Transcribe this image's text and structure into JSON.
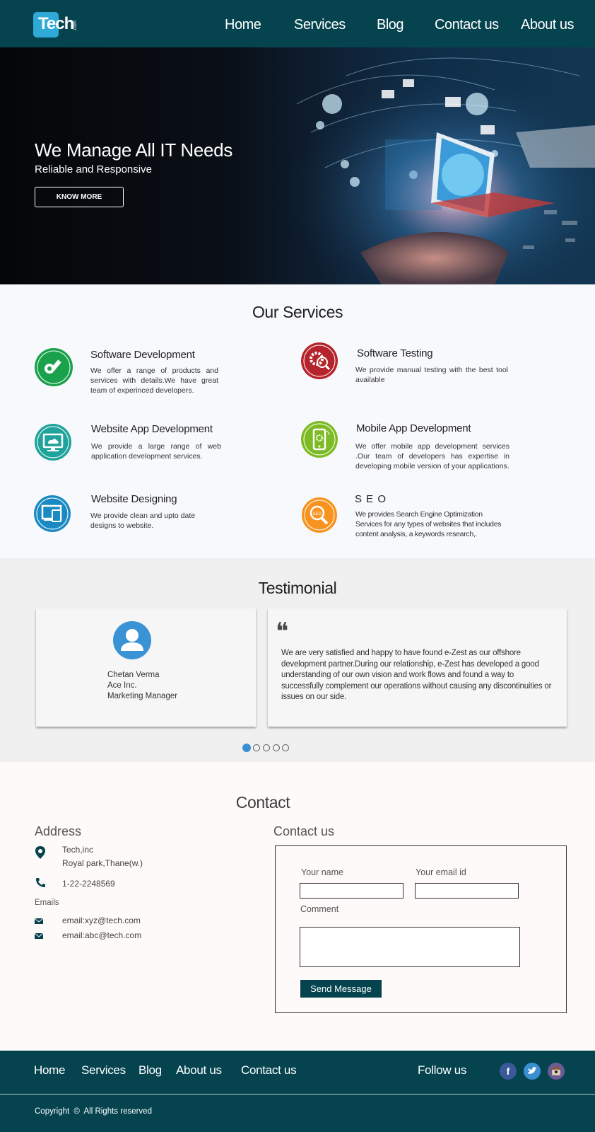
{
  "header": {
    "logo_text": "Tech",
    "logo_suffix": ".com",
    "nav": [
      "Home",
      "Services",
      "Blog",
      "Contact us",
      "About us"
    ]
  },
  "hero": {
    "title": "We Manage All IT Needs",
    "subtitle": "Reliable and Responsive",
    "button": "KNOW MORE"
  },
  "services": {
    "title": "Our Services",
    "items": [
      {
        "title": "Software Development",
        "desc": "We offer a range of products and services with details.We have great team of experinced developers.",
        "icon": "pencil-gear-icon",
        "color": "#1aa14b"
      },
      {
        "title": "Software Testing",
        "desc": "We provide manual testing with the best tool available",
        "icon": "gear-magnifier-icon",
        "color": "#b5242c"
      },
      {
        "title": "Website App Development",
        "desc": "We provide a large range of web application development services.",
        "icon": "monitor-cloud-icon",
        "color": "#1fa39a"
      },
      {
        "title": "Mobile App Development",
        "desc": "We offer mobile app development services .Our team of developers has expertise in developing mobile version of your applications.",
        "icon": "mobile-gear-icon",
        "color": "#7dbb24"
      },
      {
        "title": "Website Designing",
        "desc": "We provide clean and upto date designs to website.",
        "icon": "devices-icon",
        "color": "#1c8ac2"
      },
      {
        "title": "S E O",
        "desc": "We provides Search Engine Optimization Services for any types of websites that includes content analysis, a keywords research,.",
        "icon": "seo-magnifier-icon",
        "color": "#f7931e"
      }
    ]
  },
  "testimonial": {
    "title": "Testimonial",
    "name": "Chetan Verma",
    "company": "Ace Inc.",
    "role": "Marketing Manager",
    "quote_mark": "❝",
    "quote": "We are very satisfied and happy to have found e-Zest as our offshore development partner.During our relationship, e-Zest has developed a good understanding of our own vision and work flows and found a way to successfully complement our operations without causing any discontinuities or issues on our side.",
    "slides_total": 5,
    "slide_active": 1
  },
  "contact": {
    "title": "Contact",
    "address_heading": "Address",
    "address_line1": "Tech,inc",
    "address_line2": "Royal park,Thane(w.)",
    "phone": "1-22-2248569",
    "emails_label": "Emails",
    "email1": "email:xyz@tech.com",
    "email2": "email:abc@tech.com",
    "form_heading": "Contact us",
    "name_label": "Your name",
    "email_label": "Your email id",
    "comment_label": "Comment",
    "name_value": "",
    "email_value": "",
    "comment_value": "",
    "submit": "Send Message"
  },
  "footer": {
    "links": [
      "Home",
      "Services",
      "Blog",
      "About us",
      "Contact us"
    ],
    "follow": "Follow us",
    "social": [
      "facebook-icon",
      "twitter-icon",
      "instagram-icon"
    ],
    "copyright": "Copyright",
    "copyright_symbol": "©",
    "rights": "All Rights reserved"
  },
  "colors": {
    "brand": "#05434f",
    "accent": "#3a8fd1"
  }
}
